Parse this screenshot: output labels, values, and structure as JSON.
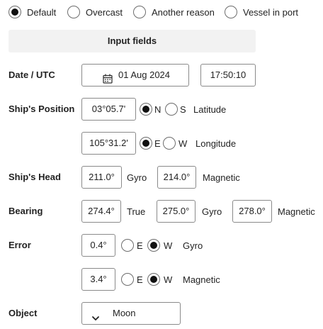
{
  "mode_options": [
    {
      "label": "Default",
      "selected": true
    },
    {
      "label": "Overcast",
      "selected": false
    },
    {
      "label": "Another reason",
      "selected": false
    },
    {
      "label": "Vessel in port",
      "selected": false
    }
  ],
  "section_title": "Input fields",
  "date_utc": {
    "label": "Date / UTC",
    "date": "01 Aug 2024",
    "time": "17:50:10",
    "icon": "calendar-icon"
  },
  "ships_position": {
    "label": "Ship's Position",
    "lat_value": "03°05.7'",
    "lat_hemispheres": [
      {
        "label": "N",
        "selected": true
      },
      {
        "label": "S",
        "selected": false
      }
    ],
    "lat_caption": "Latitude",
    "lon_value": "105°31.2'",
    "lon_hemispheres": [
      {
        "label": "E",
        "selected": true
      },
      {
        "label": "W",
        "selected": false
      }
    ],
    "lon_caption": "Longitude"
  },
  "ships_head": {
    "label": "Ship's Head",
    "gyro_value": "211.0°",
    "gyro_caption": "Gyro",
    "magnetic_value": "214.0°",
    "magnetic_caption": "Magnetic"
  },
  "bearing": {
    "label": "Bearing",
    "true_value": "274.4°",
    "true_caption": "True",
    "gyro_value": "275.0°",
    "gyro_caption": "Gyro",
    "magnetic_value": "278.0°",
    "magnetic_caption": "Magnetic"
  },
  "error": {
    "label": "Error",
    "gyro_value": "0.4°",
    "gyro_dirs": [
      {
        "label": "E",
        "selected": false
      },
      {
        "label": "W",
        "selected": true
      }
    ],
    "gyro_caption": "Gyro",
    "magnetic_value": "3.4°",
    "magnetic_dirs": [
      {
        "label": "E",
        "selected": false
      },
      {
        "label": "W",
        "selected": true
      }
    ],
    "magnetic_caption": "Magnetic"
  },
  "object": {
    "label": "Object",
    "value": "Moon",
    "icon": "chevron-down-icon"
  }
}
